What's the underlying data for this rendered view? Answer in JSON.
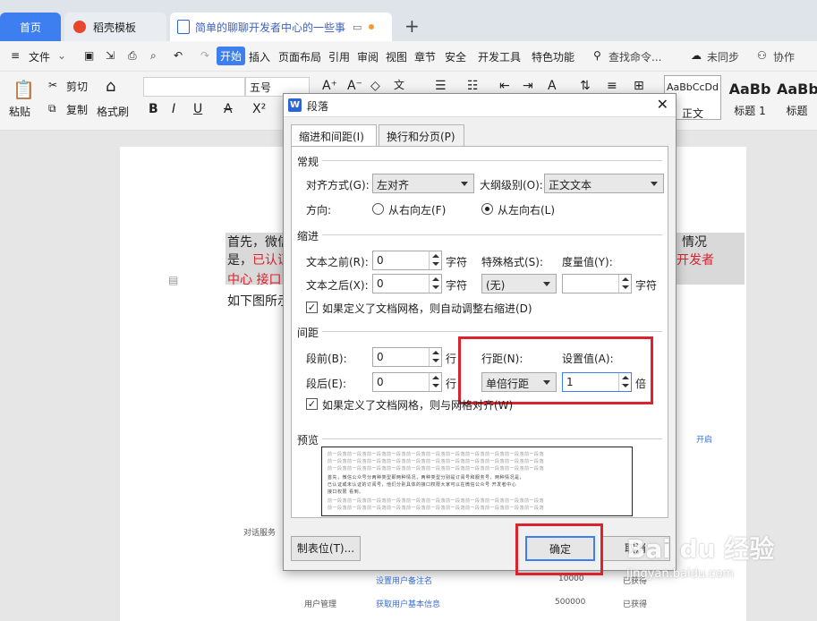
{
  "tabs": {
    "home": "首页",
    "templates": "稻壳模板",
    "document": "简单的聊聊开发者中心的一些事"
  },
  "menu": {
    "file": "文件",
    "start": "开始",
    "insert": "插入",
    "layout": "页面布局",
    "reference": "引用",
    "review": "审阅",
    "view": "视图",
    "chapter": "章节",
    "security": "安全",
    "devtools": "开发工具",
    "special": "特色功能",
    "search": "查找命令...",
    "sync": "未同步",
    "collab": "协作"
  },
  "ribbon": {
    "paste": "粘贴",
    "cut": "剪切",
    "copy": "复制",
    "format_painter": "格式刷",
    "font_size": "五号",
    "style_normal": "正文",
    "style_h1": "标题 1",
    "style_h2": "标题",
    "style_normal_preview": "AaBbCcDd",
    "style_h1_preview": "AaBb",
    "style_h2_preview": "AaBb"
  },
  "document": {
    "line1_start": "首先，微信",
    "line1_end": "情况",
    "line2_start": "是，",
    "line2_red": "已认证",
    "line2_end": "开发者",
    "line3": "中心   接口",
    "line4": "如下图所示",
    "table": {
      "row_left_1": "对话服务",
      "row_left_2": "用户管理",
      "link1": "设置用户备注名",
      "link2": "获取用户基本信息",
      "num1": "10000",
      "num2": "500000",
      "status1": "已获得",
      "status2": "已获得",
      "action": "开启"
    }
  },
  "dialog": {
    "title": "段落",
    "tab_indent": "缩进和间距(I)",
    "tab_linebreak": "换行和分页(P)",
    "section_general": "常规",
    "align_label": "对齐方式(G):",
    "align_value": "左对齐",
    "outline_label": "大纲级别(O):",
    "outline_value": "正文文本",
    "direction_label": "方向:",
    "dir_rtl": "从右向左(F)",
    "dir_ltr": "从左向右(L)",
    "section_indent": "缩进",
    "before_text_label": "文本之前(R):",
    "before_text_value": "0",
    "after_text_label": "文本之后(X):",
    "after_text_value": "0",
    "unit_char": "字符",
    "special_label": "特殊格式(S):",
    "special_value": "(无)",
    "measure_label": "度量值(Y):",
    "measure_value": "",
    "auto_indent_check": "如果定义了文档网格，则自动调整右缩进(D)",
    "section_spacing": "间距",
    "before_label": "段前(B):",
    "before_value": "0",
    "after_label": "段后(E):",
    "after_value": "0",
    "unit_line": "行",
    "line_spacing_label": "行距(N):",
    "line_spacing_value": "单倍行距",
    "setting_label": "设置值(A):",
    "setting_value": "1",
    "setting_unit": "倍",
    "grid_align_check": "如果定义了文档网格，则与网格对齐(W)",
    "section_preview": "预览",
    "preview_gray": "前一段落前一段落前一段落前一段落前一段落前一段落前一段落前一段落前一段落前一段落前一段落",
    "preview_dark_1": "首先，微信公众号分两种类型即两种情况，两种类型分别是订阅号和服务号，两种情况是，",
    "preview_dark_2": "已认证或未认证的订阅号，他们分别具体的接口权限大家可以在微信公众号  开发者中心",
    "preview_dark_3": "接口权限  看到。",
    "tab_stops": "制表位(T)...",
    "ok": "确定",
    "cancel": "取消"
  },
  "watermark": {
    "brand": "Bai du 经验",
    "url": "jingyan.baidu.com"
  },
  "colors": {
    "accent": "#3d7ff0",
    "highlight": "#d9232d"
  }
}
